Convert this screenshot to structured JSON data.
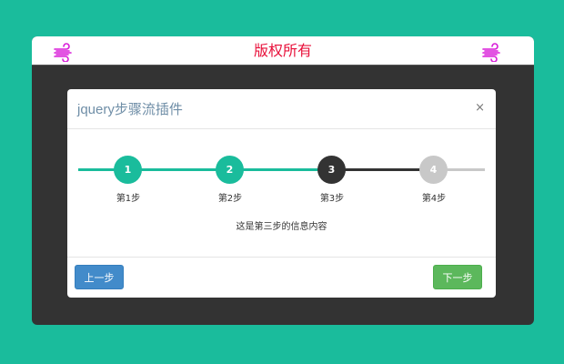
{
  "header": {
    "title": "版权所有",
    "left_icon": "wind-icon",
    "right_icon": "wind-icon",
    "accent": "#e8103a",
    "icon_color": "#d81bd8"
  },
  "modal": {
    "title": "jquery步骤流插件",
    "close_label": "×",
    "steps": [
      {
        "number": "1",
        "label": "第1步",
        "state": "done",
        "color": "#1abc9c"
      },
      {
        "number": "2",
        "label": "第2步",
        "state": "done",
        "color": "#1abc9c"
      },
      {
        "number": "3",
        "label": "第3步",
        "state": "current",
        "color": "#333333"
      },
      {
        "number": "4",
        "label": "第4步",
        "state": "todo",
        "color": "#c8c8c8"
      }
    ],
    "info": "这是第三步的信息内容",
    "prev_label": "上一步",
    "next_label": "下一步"
  }
}
